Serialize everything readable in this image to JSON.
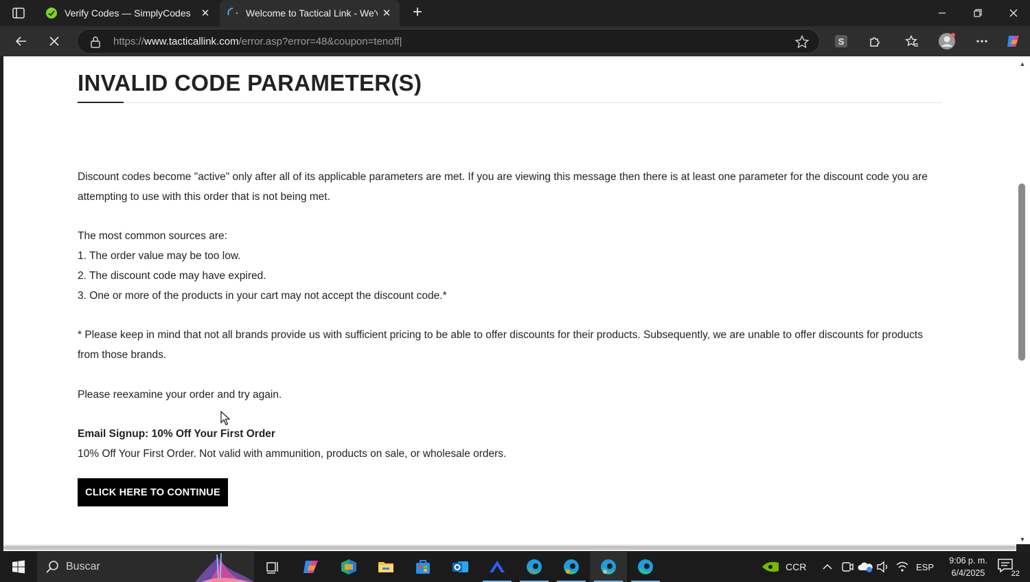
{
  "browser": {
    "tabs": [
      {
        "title": "Verify Codes — SimplyCodes",
        "active": false
      },
      {
        "title": "Welcome to Tactical Link - We've",
        "active": true
      }
    ],
    "address": {
      "scheme": "https://",
      "host": "www.tacticallink.com",
      "path": "/error.asp?error=48&coupon=tenoff|"
    },
    "toolbar_icons": [
      "back-icon",
      "stop-loading-icon",
      "simplycodes-extension-icon",
      "extensions-icon",
      "favorites-icon",
      "profile-icon",
      "more-icon",
      "copilot-icon"
    ]
  },
  "page": {
    "heading": "INVALID CODE PARAMETER(S)",
    "para1": "Discount codes become \"active\" only after all of its applicable parameters are met. If you are viewing this message then there is at least one parameter for the discount code you are attempting to use with this order that is not being met.",
    "sources_intro": "The most common sources are:",
    "sources": [
      "1. The order value may be too low.",
      "2. The discount code may have expired.",
      "3. One or more of the products in your cart may not accept the discount code.*"
    ],
    "footnote": "* Please keep in mind that not all brands provide us with sufficient pricing to be able to offer discounts for their products. Subsequently, we are unable to offer discounts for products from those brands.",
    "reexamine": "Please reexamine your order and try again.",
    "promo_title": "Email Signup: 10% Off Your First Order",
    "promo_desc": "10% Off Your First Order. Not valid with ammunition, products on sale, or wholesale orders.",
    "cta": "CLICK HERE TO CONTINUE"
  },
  "taskbar": {
    "search_placeholder": "Buscar",
    "tray_ccr": "CCR",
    "language": "ESP",
    "time": "9:06 p. m.",
    "date": "6/4/2025",
    "notifications": "22"
  }
}
